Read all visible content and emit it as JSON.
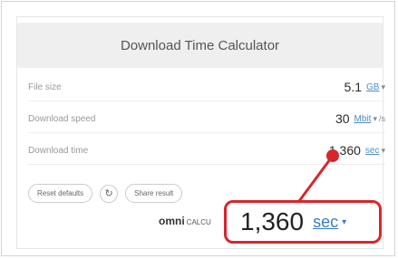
{
  "calculator": {
    "title": "Download Time Calculator",
    "rows": [
      {
        "label": "File size",
        "value": "5.1",
        "unit": "GB",
        "suffix": ""
      },
      {
        "label": "Download speed",
        "value": "30",
        "unit": "Mbit",
        "suffix": "/s"
      },
      {
        "label": "Download time",
        "value": "1,360",
        "unit": "sec",
        "suffix": ""
      }
    ],
    "buttons": {
      "reset": "Reset defaults",
      "reload_icon": "reload-icon",
      "share": "Share result"
    },
    "brand": {
      "name": "omni",
      "sub": "CALCU"
    }
  },
  "callout": {
    "value": "1,360",
    "unit": "sec",
    "color": "#d9262c"
  }
}
